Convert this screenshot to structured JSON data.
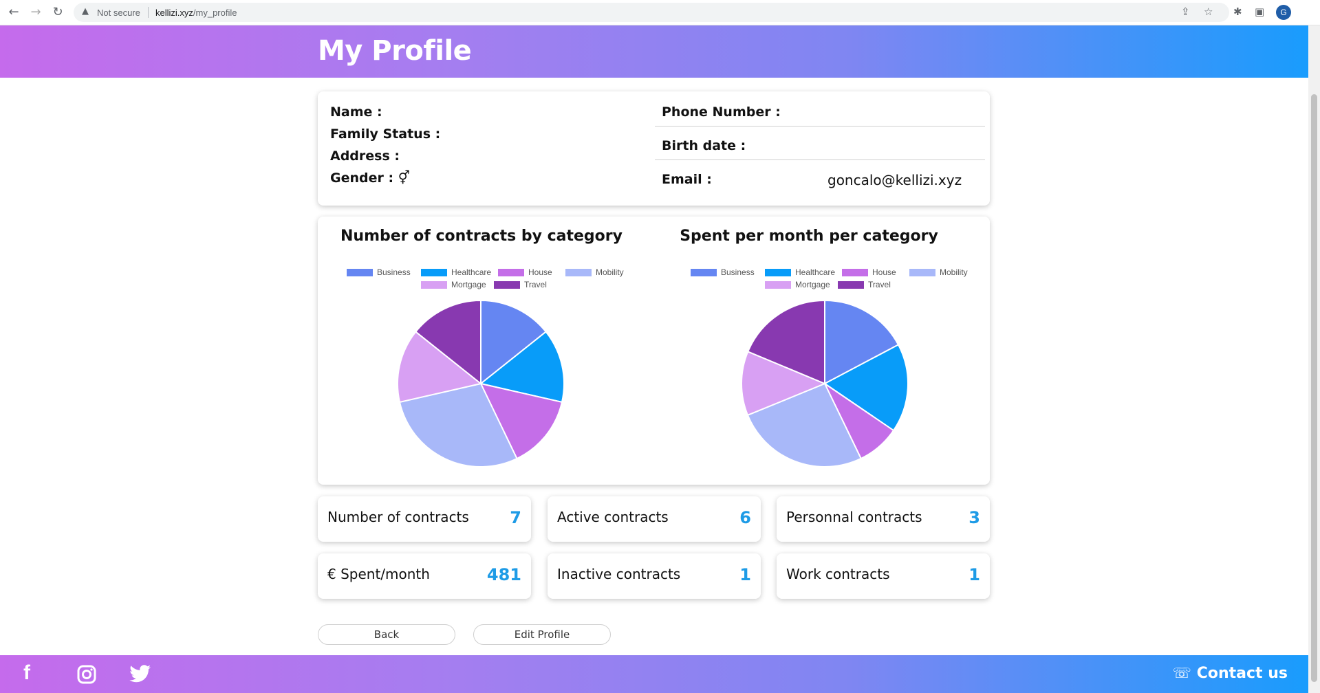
{
  "browser": {
    "security_label": "Not secure",
    "url_host": "kellizi.xyz",
    "url_path": "/my_profile",
    "profile_initial": "G"
  },
  "header": {
    "title": "My Profile"
  },
  "profile": {
    "name_label": "Name :",
    "family_status_label": "Family Status :",
    "address_label": "Address :",
    "gender_label": "Gender :",
    "gender_symbol": "⚥",
    "phone_label": "Phone Number :",
    "birth_label": "Birth date :",
    "email_label": "Email :",
    "email_value": "goncalo@kellizi.xyz"
  },
  "chart_data": [
    {
      "type": "pie",
      "title": "Number of contracts by category",
      "categories": [
        "Business",
        "Healthcare",
        "House",
        "Mobility",
        "Mortgage",
        "Travel"
      ],
      "values": [
        1,
        1,
        1,
        2,
        1,
        1
      ],
      "colors": [
        "#6586f2",
        "#089cf9",
        "#c46ee8",
        "#a8b8f9",
        "#d8a0f3",
        "#8839b0"
      ]
    },
    {
      "type": "pie",
      "title": "Spent per month per category",
      "categories": [
        "Business",
        "Healthcare",
        "House",
        "Mobility",
        "Mortgage",
        "Travel"
      ],
      "values": [
        83,
        83,
        40,
        125,
        60,
        90
      ],
      "colors": [
        "#6586f2",
        "#089cf9",
        "#c46ee8",
        "#a8b8f9",
        "#d8a0f3",
        "#8839b0"
      ]
    }
  ],
  "stats": [
    {
      "label": "Number of contracts",
      "value": "7"
    },
    {
      "label": "Active contracts",
      "value": "6"
    },
    {
      "label": "Personnal contracts",
      "value": "3"
    },
    {
      "label": "€ Spent/month",
      "value": "481"
    },
    {
      "label": "Inactive contracts",
      "value": "1"
    },
    {
      "label": "Work contracts",
      "value": "1"
    }
  ],
  "buttons": {
    "back": "Back",
    "edit": "Edit Profile"
  },
  "footer": {
    "facebook_icon": "f",
    "contact_label": "Contact us",
    "contact_icon": "☏"
  }
}
